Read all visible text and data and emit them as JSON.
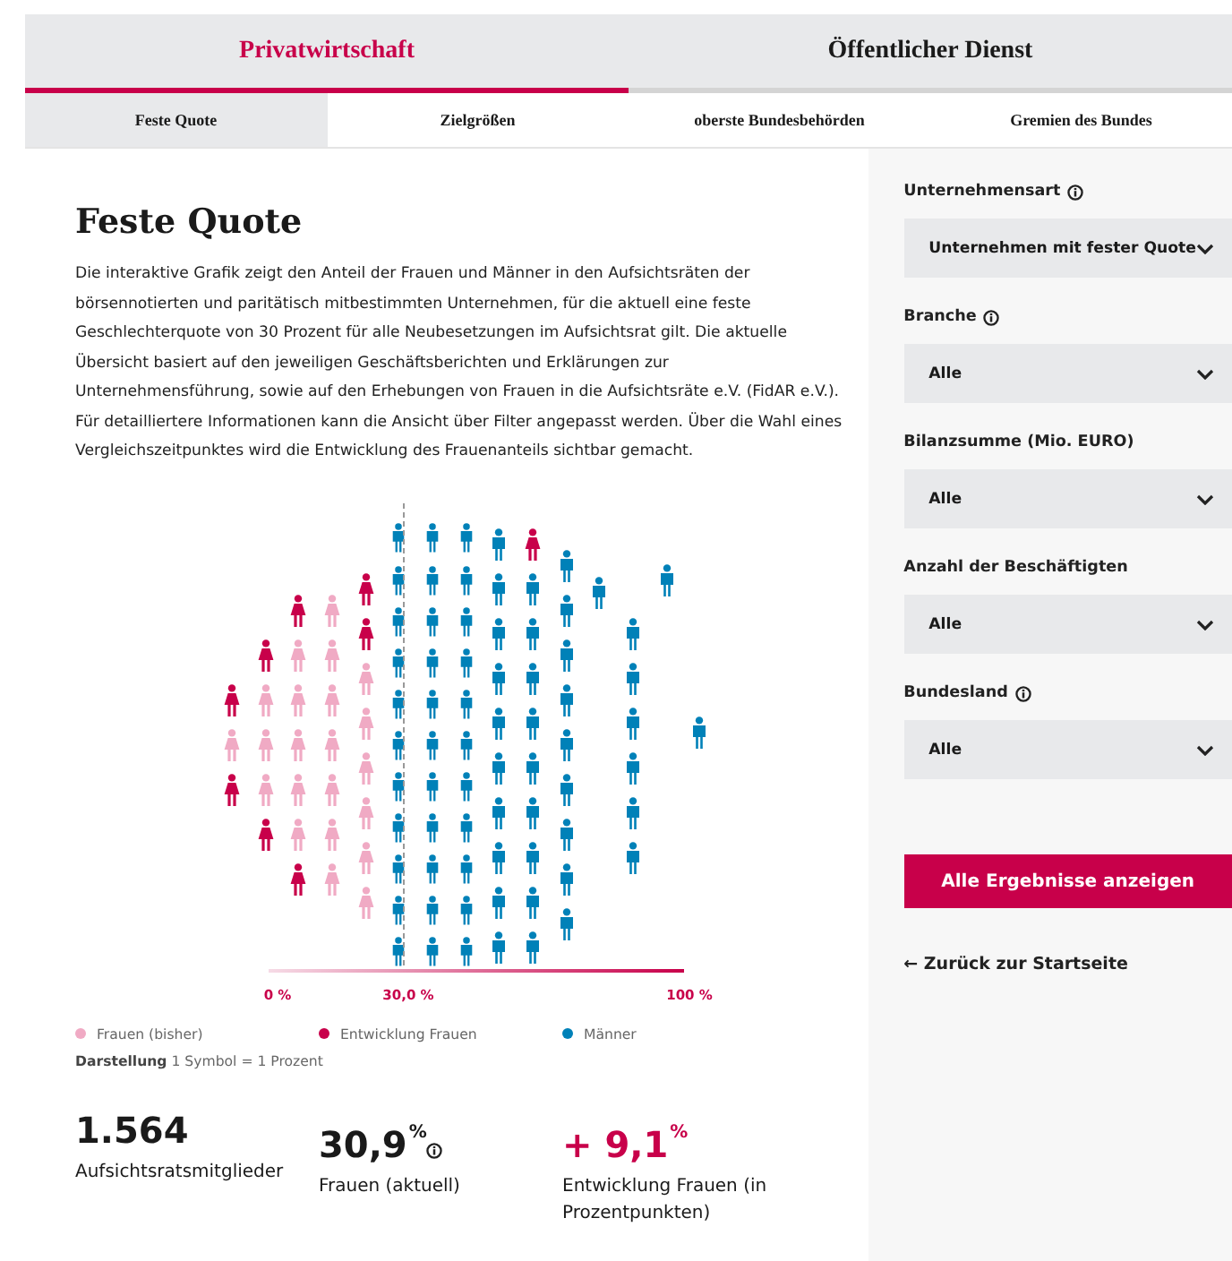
{
  "main_tabs": [
    {
      "label": "Privatwirtschaft",
      "selected": true
    },
    {
      "label": "Öffentlicher Dienst",
      "selected": false
    }
  ],
  "sub_tabs": [
    {
      "label": "Feste Quote",
      "selected": true
    },
    {
      "label": "Zielgrößen",
      "selected": false
    },
    {
      "label": "oberste Bundesbehörden",
      "selected": false
    },
    {
      "label": "Gremien des Bundes",
      "selected": false
    }
  ],
  "title": "Feste Quote",
  "description": "Die interaktive Grafik zeigt den Anteil der Frauen und Männer in den Aufsichtsräten der börsennotierten und paritätisch mitbestimmten Unternehmen, für die aktuell eine feste Geschlechterquote von 30 Prozent für alle Neubesetzungen im Aufsichtsrat gilt. Die aktuelle Übersicht basiert auf den jeweiligen Geschäftsberichten und Erklärungen zur Unternehmensführung, sowie auf den Erhebungen von Frauen in die Aufsichtsräte e.V. (FidAR e.V.). Für detailliertere Informationen kann die Ansicht über Filter angepasst werden. Über die Wahl eines Vergleichszeitpunktes wird die Entwicklung des Frauenanteils sichtbar gemacht.",
  "pictogram": {
    "columns": [
      [
        {
          "kind": "growth"
        },
        {
          "kind": "before"
        },
        {
          "kind": "growth"
        }
      ],
      [
        {
          "kind": "growth"
        },
        {
          "kind": "before"
        },
        {
          "kind": "before"
        },
        {
          "kind": "before"
        },
        {
          "kind": "growth"
        }
      ],
      [
        {
          "kind": "growth"
        },
        {
          "kind": "before"
        },
        {
          "kind": "before"
        },
        {
          "kind": "before"
        },
        {
          "kind": "before"
        },
        {
          "kind": "before"
        },
        {
          "kind": "growth"
        }
      ],
      [
        {
          "kind": "before"
        },
        {
          "kind": "before"
        },
        {
          "kind": "before"
        },
        {
          "kind": "before"
        },
        {
          "kind": "before"
        },
        {
          "kind": "before"
        },
        {
          "kind": "before"
        }
      ],
      [
        {
          "kind": "growth"
        },
        {
          "kind": "growth"
        },
        {
          "kind": "before"
        },
        {
          "kind": "before"
        },
        {
          "kind": "before"
        },
        {
          "kind": "before"
        },
        {
          "kind": "before"
        },
        {
          "kind": "before"
        }
      ],
      [
        {
          "kind": "men"
        },
        {
          "kind": "men"
        },
        {
          "kind": "men"
        },
        {
          "kind": "men"
        },
        {
          "kind": "men"
        },
        {
          "kind": "men"
        },
        {
          "kind": "men"
        },
        {
          "kind": "men"
        },
        {
          "kind": "men"
        },
        {
          "kind": "men"
        },
        {
          "kind": "men"
        }
      ],
      [
        {
          "kind": "men"
        },
        {
          "kind": "men"
        },
        {
          "kind": "men"
        },
        {
          "kind": "men"
        },
        {
          "kind": "men"
        },
        {
          "kind": "men"
        },
        {
          "kind": "men"
        },
        {
          "kind": "men"
        },
        {
          "kind": "men"
        },
        {
          "kind": "men"
        },
        {
          "kind": "men"
        }
      ],
      [
        {
          "kind": "men"
        },
        {
          "kind": "men"
        },
        {
          "kind": "men"
        },
        {
          "kind": "men"
        },
        {
          "kind": "men"
        },
        {
          "kind": "men"
        },
        {
          "kind": "men"
        },
        {
          "kind": "men"
        },
        {
          "kind": "men"
        },
        {
          "kind": "men"
        },
        {
          "kind": "men"
        }
      ],
      [
        {
          "kind": "men"
        },
        {
          "kind": "men"
        },
        {
          "kind": "men"
        },
        {
          "kind": "men"
        },
        {
          "kind": "men"
        },
        {
          "kind": "men"
        },
        {
          "kind": "men"
        },
        {
          "kind": "men"
        },
        {
          "kind": "men"
        },
        {
          "kind": "men"
        }
      ],
      [
        {
          "kind": "growth"
        },
        {
          "kind": "men"
        },
        {
          "kind": "men"
        },
        {
          "kind": "men"
        },
        {
          "kind": "men"
        },
        {
          "kind": "men"
        },
        {
          "kind": "men"
        },
        {
          "kind": "men"
        },
        {
          "kind": "men"
        },
        {
          "kind": "men"
        }
      ],
      [
        {
          "kind": "men"
        },
        {
          "kind": "men"
        },
        {
          "kind": "men"
        },
        {
          "kind": "men"
        },
        {
          "kind": "men"
        },
        {
          "kind": "men"
        },
        {
          "kind": "men"
        },
        {
          "kind": "men"
        },
        {
          "kind": "men"
        }
      ],
      [
        {
          "kind": "men"
        }
      ],
      [
        {
          "kind": "men"
        },
        {
          "kind": "men"
        },
        {
          "kind": "men"
        },
        {
          "kind": "men"
        },
        {
          "kind": "men"
        },
        {
          "kind": "men"
        }
      ],
      [
        {
          "kind": "men"
        }
      ],
      [
        {
          "kind": "men"
        }
      ]
    ],
    "axis_labels": [
      {
        "label": "0 %",
        "kind": "start"
      },
      {
        "label": "30,0 %",
        "kind": "marker"
      },
      {
        "label": "100 %",
        "kind": "end"
      }
    ]
  },
  "legend": [
    {
      "label": "Frauen (bisher)",
      "color": "#f0aac4"
    },
    {
      "label": "Entwicklung Frauen",
      "color": "#c8004a"
    },
    {
      "label": "Männer",
      "color": "#0081b8"
    }
  ],
  "scale_note": "**Darstellung** 1 Symbol = 1 Prozent",
  "stats": [
    {
      "value": "1.564",
      "label": "Aufsichtsratsmitglieder",
      "kind": "plain"
    },
    {
      "value": "30,9",
      "unit": "%",
      "label": "Frauen (aktuell)",
      "kind": "info"
    },
    {
      "value": "+ 9,1",
      "unit": "%",
      "label": "Entwicklung Frauen (in Prozentpunkten)",
      "kind": "highlight"
    }
  ],
  "filters": [
    {
      "label": "Unternehmensart",
      "info": true,
      "value": "Unternehmen mit fester Quote"
    },
    {
      "label": "Branche",
      "info": true,
      "value": "Alle"
    },
    {
      "label": "Bilanzsumme (Mio. EURO)",
      "info": false,
      "value": "Alle"
    },
    {
      "label": "Anzahl der Beschäftigten",
      "info": false,
      "value": "Alle"
    },
    {
      "label": "Bundesland",
      "info": true,
      "value": "Alle"
    }
  ],
  "submit_button": "Alle Ergebnisse anzeigen",
  "back_link": "← Zurück zur Startseite"
}
